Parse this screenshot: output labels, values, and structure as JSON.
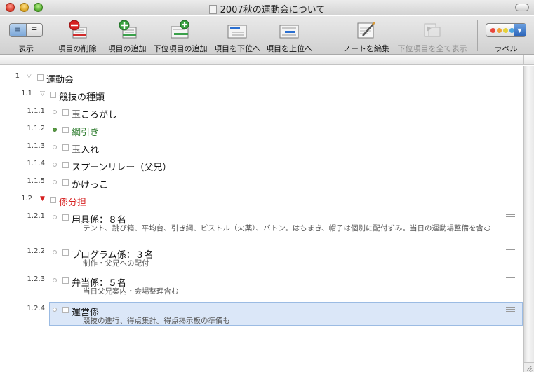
{
  "window": {
    "title": "2007秋の運動会について"
  },
  "toolbar": {
    "view_label": "表示",
    "view_modes": [
      "≣",
      "☰"
    ],
    "delete_label": "項目の削除",
    "add_label": "項目の追加",
    "add_child_label": "下位項目の追加",
    "demote_label": "項目を下位へ",
    "promote_label": "項目を上位へ",
    "edit_note_label": "ノートを編集",
    "show_children_label": "下位項目を全て表示",
    "label_label": "ラベル",
    "label_colors": [
      "#e8463c",
      "#f0a23a",
      "#e5d23a",
      "#4aa3e0"
    ]
  },
  "outline": {
    "items": [
      {
        "num": "1",
        "title": "運動会",
        "expanded": true
      },
      {
        "num": "1.1",
        "title": "競技の種類",
        "expanded": true
      },
      {
        "num": "1.1.1",
        "title": "玉ころがし"
      },
      {
        "num": "1.1.2",
        "title": "綱引き",
        "color": "#2f7d2f"
      },
      {
        "num": "1.1.3",
        "title": "玉入れ"
      },
      {
        "num": "1.1.4",
        "title": "スプーンリレー（父兄）"
      },
      {
        "num": "1.1.5",
        "title": "かけっこ"
      },
      {
        "num": "1.2",
        "title": "係分担",
        "expanded": true,
        "color": "#d62020"
      },
      {
        "num": "1.2.1",
        "title": "用具係：８名",
        "note": "テント、跳び箱、平均台、引き綱、ピストル（火薬）、バトン。はちまき、帽子は個別に配付ずみ。当日の運動場整備を含む"
      },
      {
        "num": "1.2.2",
        "title": "プログラム係：３名",
        "note": "制作・父兄への配付"
      },
      {
        "num": "1.2.3",
        "title": "弁当係：５名",
        "note": "当日父兄案内・会場整理含む"
      },
      {
        "num": "1.2.4",
        "title": "運営係",
        "note": "競技の進行、得点集計。得点掲示板の準備も",
        "selected": true
      }
    ]
  }
}
